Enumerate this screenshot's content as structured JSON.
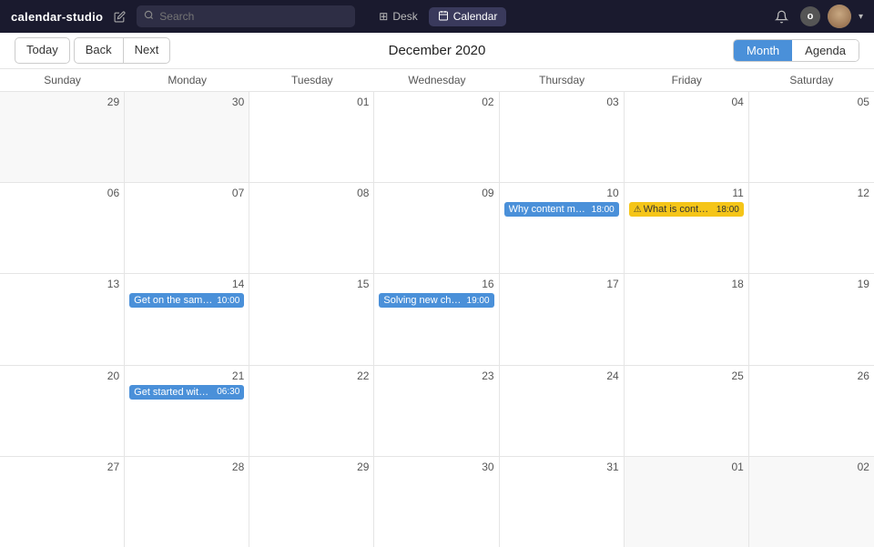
{
  "app": {
    "title": "calendar-studio"
  },
  "topnav": {
    "search_placeholder": "Search",
    "tabs": [
      {
        "label": "Desk",
        "icon": "grid",
        "active": false
      },
      {
        "label": "Calendar",
        "icon": "calendar",
        "active": true
      }
    ]
  },
  "controls": {
    "today_label": "Today",
    "back_label": "Back",
    "next_label": "Next",
    "month_title": "December 2020",
    "view_month_label": "Month",
    "view_agenda_label": "Agenda"
  },
  "days_of_week": [
    "Sunday",
    "Monday",
    "Tuesday",
    "Wednesday",
    "Thursday",
    "Friday",
    "Saturday"
  ],
  "weeks": [
    {
      "days": [
        {
          "num": "29",
          "other": true,
          "events": []
        },
        {
          "num": "30",
          "other": true,
          "events": []
        },
        {
          "num": "01",
          "other": false,
          "events": []
        },
        {
          "num": "02",
          "other": false,
          "today": true,
          "events": []
        },
        {
          "num": "03",
          "other": false,
          "events": []
        },
        {
          "num": "04",
          "other": false,
          "events": []
        },
        {
          "num": "05",
          "other": false,
          "events": []
        }
      ]
    },
    {
      "days": [
        {
          "num": "06",
          "other": false,
          "events": []
        },
        {
          "num": "07",
          "other": false,
          "events": []
        },
        {
          "num": "08",
          "other": false,
          "events": []
        },
        {
          "num": "09",
          "other": false,
          "events": []
        },
        {
          "num": "10",
          "other": false,
          "events": [
            {
              "title": "Why content modelin...",
              "time": "18:00",
              "type": "blue"
            }
          ]
        },
        {
          "num": "11",
          "other": false,
          "events": [
            {
              "title": "What is content m...",
              "time": "18:00",
              "type": "yellow",
              "icon": "⚠"
            }
          ]
        },
        {
          "num": "12",
          "other": false,
          "events": []
        }
      ]
    },
    {
      "days": [
        {
          "num": "13",
          "other": false,
          "events": []
        },
        {
          "num": "14",
          "other": false,
          "events": [
            {
              "title": "Get on the same pag...",
              "time": "10:00",
              "type": "blue"
            }
          ]
        },
        {
          "num": "15",
          "other": false,
          "events": []
        },
        {
          "num": "16",
          "other": false,
          "events": [
            {
              "title": "Solving new challeng...",
              "time": "19:00",
              "type": "blue"
            }
          ]
        },
        {
          "num": "17",
          "other": false,
          "events": []
        },
        {
          "num": "18",
          "other": false,
          "events": []
        },
        {
          "num": "19",
          "other": false,
          "events": []
        }
      ]
    },
    {
      "days": [
        {
          "num": "20",
          "other": false,
          "events": []
        },
        {
          "num": "21",
          "other": false,
          "events": [
            {
              "title": "Get started with the ...",
              "time": "06:30",
              "type": "blue"
            }
          ]
        },
        {
          "num": "22",
          "other": false,
          "events": []
        },
        {
          "num": "23",
          "other": false,
          "events": []
        },
        {
          "num": "24",
          "other": false,
          "events": []
        },
        {
          "num": "25",
          "other": false,
          "events": []
        },
        {
          "num": "26",
          "other": false,
          "events": []
        }
      ]
    },
    {
      "days": [
        {
          "num": "27",
          "other": false,
          "events": []
        },
        {
          "num": "28",
          "other": false,
          "events": []
        },
        {
          "num": "29",
          "other": false,
          "events": []
        },
        {
          "num": "30",
          "other": false,
          "events": []
        },
        {
          "num": "31",
          "other": false,
          "events": []
        },
        {
          "num": "01",
          "other": true,
          "events": []
        },
        {
          "num": "02",
          "other": true,
          "events": []
        }
      ]
    }
  ]
}
